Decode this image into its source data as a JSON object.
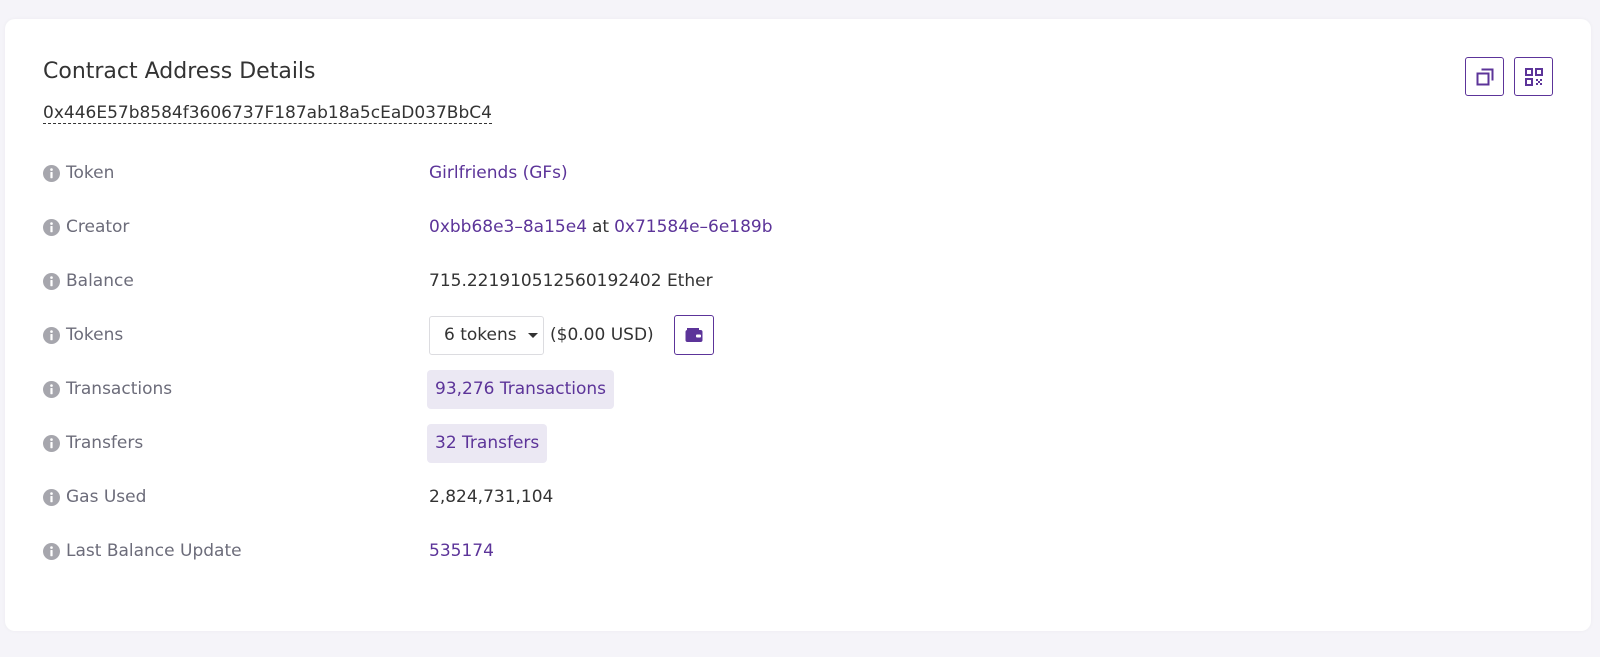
{
  "header": {
    "title": "Contract Address Details",
    "address": "0x446E57b8584f3606737F187ab18a5cEaD037BbC4"
  },
  "actions": {
    "copy_icon": "copy-icon",
    "qr_icon": "qr-code-icon"
  },
  "rows": {
    "token": {
      "label": "Token",
      "value": "Girlfriends (GFs)"
    },
    "creator": {
      "label": "Creator",
      "address": "0xbb68e3–8a15e4",
      "at": "at",
      "tx": "0x71584e–6e189b"
    },
    "balance": {
      "label": "Balance",
      "value": "715.221910512560192402 Ether"
    },
    "tokens": {
      "label": "Tokens",
      "dropdown": "6 tokens",
      "usd": "($0.00 USD)",
      "wallet_icon": "wallet-icon"
    },
    "transactions": {
      "label": "Transactions",
      "value": "93,276 Transactions"
    },
    "transfers": {
      "label": "Transfers",
      "value": "32 Transfers"
    },
    "gas_used": {
      "label": "Gas Used",
      "value": "2,824,731,104"
    },
    "last_balance_update": {
      "label": "Last Balance Update",
      "value": "535174"
    }
  },
  "colors": {
    "accent": "#5c3499",
    "pill_bg": "#ebe8f3",
    "label": "#6c6c7a"
  }
}
